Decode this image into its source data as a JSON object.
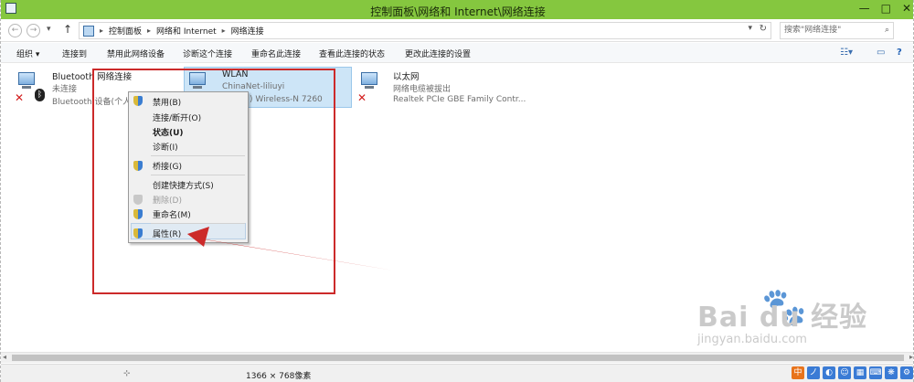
{
  "window": {
    "title": "控制面板\\网络和 Internet\\网络连接",
    "buttons": [
      "—",
      "□",
      "✕"
    ]
  },
  "address": {
    "crumbs": [
      "控制面板",
      "网络和 Internet",
      "网络连接"
    ],
    "search_placeholder": "搜索\"网络连接\""
  },
  "toolbar": {
    "items": [
      "组织 ▾",
      "连接到",
      "禁用此网络设备",
      "诊断这个连接",
      "重命名此连接",
      "查看此连接的状态",
      "更改此连接的设置"
    ]
  },
  "connections": [
    {
      "name": "Bluetooth 网络连接",
      "status": "未连接",
      "device": "Bluetooth 设备(个人"
    },
    {
      "name": "WLAN",
      "status": "ChinaNet-liliuyi",
      "device": ") Wireless-N 7260"
    },
    {
      "name": "以太网",
      "status": "网络电缆被拔出",
      "device": "Realtek PCIe GBE Family Contr..."
    }
  ],
  "context_menu": {
    "items": [
      {
        "label": "禁用(B)",
        "shield": true
      },
      {
        "label": "连接/断开(O)",
        "shield": false
      },
      {
        "label": "状态(U)",
        "shield": false,
        "bold": true
      },
      {
        "label": "诊断(I)",
        "shield": false
      },
      {
        "label": "桥接(G)",
        "shield": true
      },
      {
        "label": "创建快捷方式(S)",
        "shield": false
      },
      {
        "label": "删除(D)",
        "shield": true,
        "disabled": true
      },
      {
        "label": "重命名(M)",
        "shield": true
      },
      {
        "label": "属性(R)",
        "shield": true
      }
    ]
  },
  "statusbar": {
    "dims": "1366 × 768像素"
  },
  "tray": [
    "中",
    "ノ",
    "◐",
    "☺",
    "▦",
    "⌨",
    "❋",
    "⚙"
  ],
  "watermark": {
    "brand": "Bai du 经验",
    "url": "jingyan.baidu.com"
  },
  "colors": {
    "titlebar": "#85c73f",
    "annotation_red": "#cc2a2a",
    "selection": "#cde5f7"
  }
}
